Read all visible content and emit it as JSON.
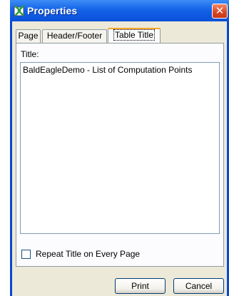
{
  "window": {
    "title": "Properties",
    "close_glyph": "✕",
    "app_icon": "properties-app-icon"
  },
  "tabs": [
    {
      "label": "Page",
      "active": false
    },
    {
      "label": "Header/Footer",
      "active": false
    },
    {
      "label": "Table Title",
      "active": true
    }
  ],
  "form": {
    "title_label": "Title:",
    "title_value": "BaldEagleDemo - List of Computation Points",
    "repeat_label": "Repeat Title on Every Page",
    "repeat_checked": false
  },
  "buttons": {
    "print": "Print",
    "cancel": "Cancel"
  },
  "colors": {
    "titlebar": "#0a4fd9",
    "close": "#d9441f",
    "face": "#ece9d8",
    "active_tab_accent": "#f5a52b"
  }
}
